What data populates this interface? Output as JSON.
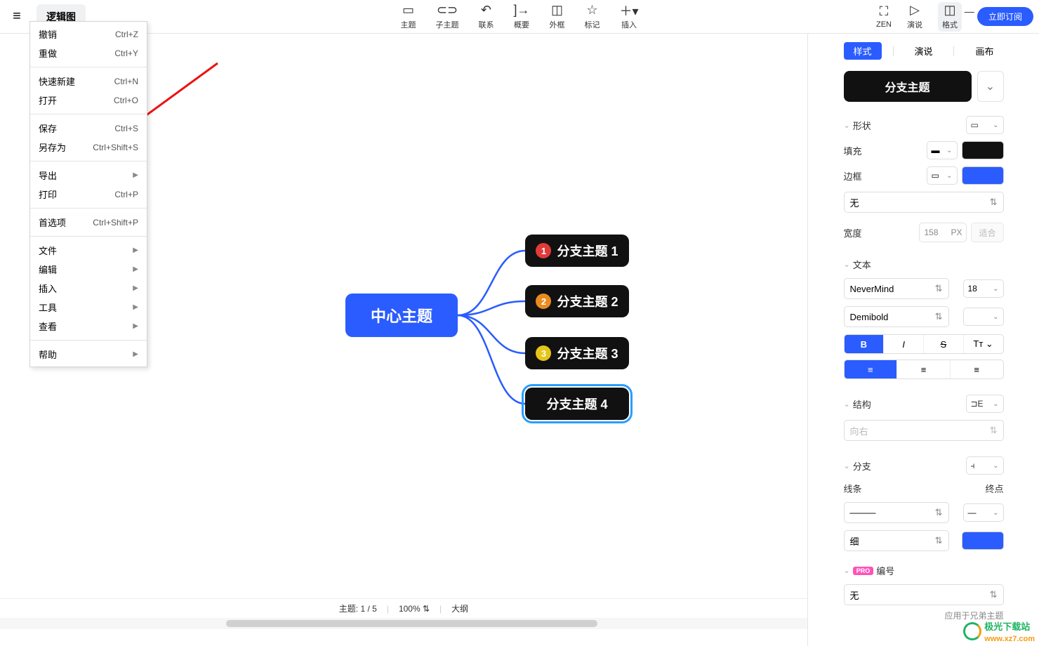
{
  "window": {
    "title_tab": "逻辑图"
  },
  "toolbar": {
    "items": [
      {
        "label": "主题"
      },
      {
        "label": "子主题"
      },
      {
        "label": "联系"
      },
      {
        "label": "概要"
      },
      {
        "label": "外框"
      },
      {
        "label": "标记"
      },
      {
        "label": "插入"
      }
    ],
    "zen": "ZEN",
    "demo": "演说",
    "format": "格式",
    "subscribe": "立即订阅"
  },
  "menu": {
    "undo": {
      "label": "撤销",
      "shortcut": "Ctrl+Z"
    },
    "redo": {
      "label": "重做",
      "shortcut": "Ctrl+Y"
    },
    "quicknew": {
      "label": "快速新建",
      "shortcut": "Ctrl+N"
    },
    "open": {
      "label": "打开",
      "shortcut": "Ctrl+O"
    },
    "save": {
      "label": "保存",
      "shortcut": "Ctrl+S"
    },
    "saveas": {
      "label": "另存为",
      "shortcut": "Ctrl+Shift+S"
    },
    "export": {
      "label": "导出"
    },
    "print": {
      "label": "打印",
      "shortcut": "Ctrl+P"
    },
    "prefs": {
      "label": "首选项",
      "shortcut": "Ctrl+Shift+P"
    },
    "file": {
      "label": "文件"
    },
    "edit": {
      "label": "编辑"
    },
    "insert": {
      "label": "插入"
    },
    "tools": {
      "label": "工具"
    },
    "view": {
      "label": "查看"
    },
    "help": {
      "label": "帮助"
    }
  },
  "mindmap": {
    "center": "中心主题",
    "b1": "分支主题 1",
    "b2": "分支主题 2",
    "b3": "分支主题 3",
    "b4": "分支主题 4"
  },
  "panel": {
    "tab_style": "样式",
    "tab_present": "演说",
    "tab_canvas": "画布",
    "chip": "分支主题",
    "shape": "形状",
    "fill": "填充",
    "border": "边框",
    "border_style_none": "无",
    "width": "宽度",
    "width_value": "158",
    "width_unit": "PX",
    "fit": "适合",
    "text": "文本",
    "font_family": "NeverMind",
    "font_size": "18",
    "font_weight": "Demibold",
    "structure": "结构",
    "direction": "向右",
    "branch": "分支",
    "line": "线条",
    "endpoint": "终点",
    "thickness": "细",
    "numbering": "编号",
    "numbering_value": "无",
    "pro": "PRO",
    "apply_to": "应用于兄弟主题"
  },
  "status": {
    "topic": "主题: 1 / 5",
    "zoom": "100%",
    "outline": "大纲"
  },
  "watermark": {
    "text": "极光下载站",
    "url": "www.xz7.com"
  }
}
